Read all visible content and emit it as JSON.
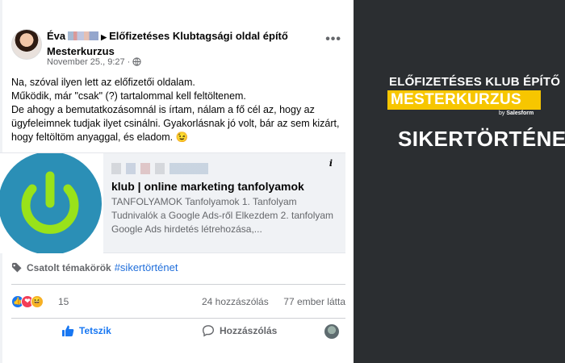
{
  "post": {
    "author_first": "Éva",
    "arrow": "▶",
    "group": "Előfizetéses Klubtagsági oldal építő Mesterkurzus",
    "timestamp": "November 25., 9:27 ·",
    "privacy_icon": "globe-icon",
    "more": "•••",
    "body": [
      "Na, szóval ilyen lett az előfizetői oldalam.",
      "Működik, már \"csak\" (?) tartalommal kell feltöltenem.",
      "De ahogy a bemutatkozásomnál is írtam, nálam a fő cél az, hogy az ügyfeleimnek tudjak ilyet csinálni. Gyakorlásnak jó volt, bár az sem kizárt, hogy feltöltöm anyaggal, és eladom. 😉"
    ],
    "link": {
      "title": "klub | online marketing tanfolyamok",
      "description": "TANFOLYAMOK Tanfolyamok 1. Tanfolyam Tudnivalók a Google Ads-ről Elkezdem 2. tanfolyam Google Ads hirdetés létrehozása,...",
      "info": "i",
      "thumb_icon": "power-icon",
      "thumb_color": "#99e21a",
      "thumb_bg": "#2b8fb6"
    },
    "topics": {
      "label": "Csatolt témakörök",
      "tag": "#sikertörténet"
    },
    "stats": {
      "reactions": [
        "👍",
        "❤",
        "😆"
      ],
      "reaction_count": "15",
      "comments": "24 hozzászólás",
      "seen": "77 ember látta"
    },
    "actions": {
      "like": "Tetszik",
      "comment": "Hozzászólás"
    }
  },
  "promo": {
    "line1": "ELŐFIZETÉSES KLUB ÉPÍTŐ",
    "line2": "MESTERKURZUS",
    "by_prefix": "by ",
    "by_brand": "Salesform",
    "line3": "SIKERTÖRTÉNET!",
    "accent": "#f7c600",
    "background": "#2b2e31"
  },
  "colors": {
    "facebook_blue": "#1877f2",
    "link_blue": "#216fdb",
    "muted": "#65676b"
  }
}
